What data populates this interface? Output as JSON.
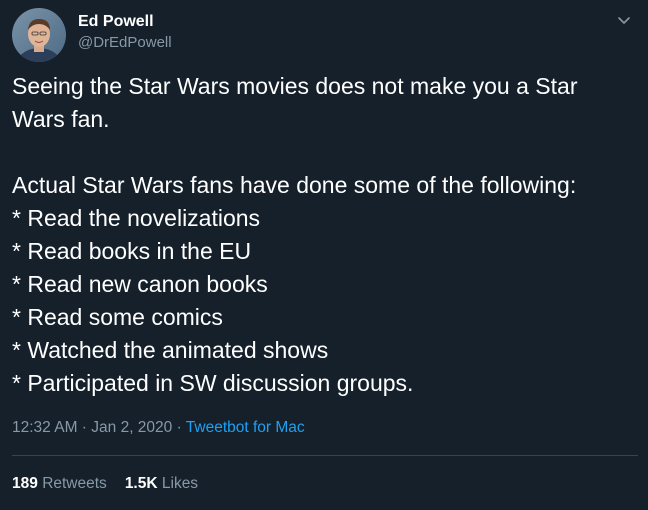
{
  "author": {
    "name": "Ed Powell",
    "handle": "@DrEdPowell",
    "avatar_icon": "user-avatar-photo"
  },
  "menu_icon": "chevron-down-icon",
  "tweet": {
    "lines": [
      "Seeing the Star Wars movies does not make you a Star",
      "Wars fan.",
      "Actual Star Wars fans have done some of the following:",
      "* Read the novelizations",
      "* Read books in the EU",
      "* Read new canon books",
      "* Read some comics",
      "* Watched the animated shows",
      "* Participated in SW discussion groups."
    ]
  },
  "meta": {
    "time": "12:32 AM",
    "separator": " · ",
    "date": "Jan 2, 2020",
    "client": "Tweetbot for Mac"
  },
  "stats": {
    "retweets_count": "189",
    "retweets_label": "Retweets",
    "likes_count": "1.5K",
    "likes_label": "Likes"
  },
  "colors": {
    "background": "#15202b",
    "text": "#ffffff",
    "muted": "#8899a6",
    "link": "#1da1f2",
    "divider": "#38444d"
  }
}
